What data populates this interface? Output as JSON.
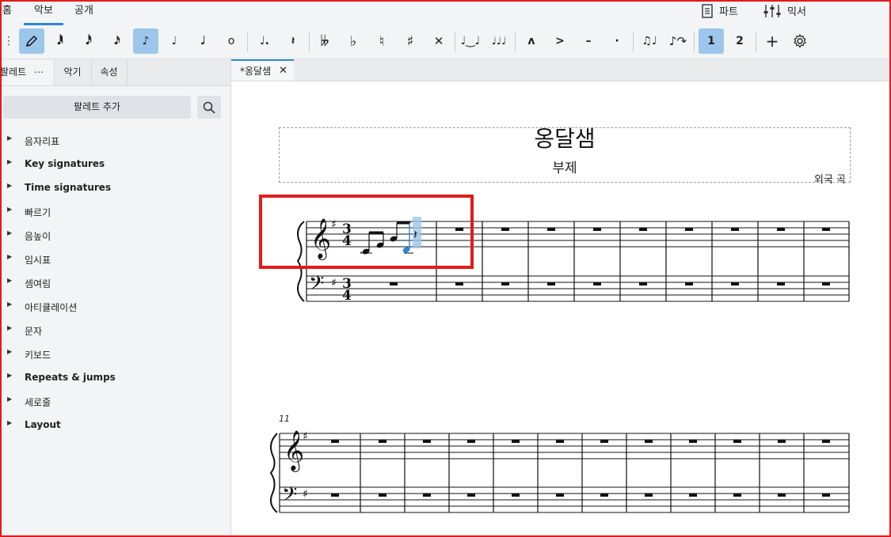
{
  "menu": {
    "tabs": [
      {
        "label": "홈"
      },
      {
        "label": "악보"
      },
      {
        "label": "공개"
      }
    ],
    "right": [
      {
        "label": "파트",
        "icon": "parts-icon"
      },
      {
        "label": "믹서",
        "icon": "mixer-icon"
      }
    ]
  },
  "toolbar": {
    "note_input_tooltip": "note-input-pencil",
    "voices": [
      "1",
      "2"
    ],
    "accent_colors": {
      "selected": "#9cc6ec",
      "blue_note": "#2f86d2"
    }
  },
  "left_panel": {
    "tabs": [
      {
        "label": "팔레트"
      },
      {
        "label": "악기"
      },
      {
        "label": "속성"
      }
    ],
    "add_palette_label": "팔레트 추가",
    "palettes": [
      {
        "label": "음자리표",
        "bold": false
      },
      {
        "label": "Key signatures",
        "bold": true
      },
      {
        "label": "Time signatures",
        "bold": true
      },
      {
        "label": "빠르기",
        "bold": false
      },
      {
        "label": "음높이",
        "bold": false
      },
      {
        "label": "임시표",
        "bold": false
      },
      {
        "label": "셈여림",
        "bold": false
      },
      {
        "label": "아티큘레이션",
        "bold": false
      },
      {
        "label": "문자",
        "bold": false
      },
      {
        "label": "키보드",
        "bold": false
      },
      {
        "label": "Repeats & jumps",
        "bold": true
      },
      {
        "label": "세로줄",
        "bold": false
      },
      {
        "label": "Layout",
        "bold": true
      }
    ]
  },
  "document": {
    "tab_label": "*옹달샘",
    "title": "옹달샘",
    "subtitle": "부제",
    "composer": "외국 곡",
    "second_system_measure_number": "11",
    "time_signature": {
      "top": "3",
      "bottom": "4"
    }
  }
}
